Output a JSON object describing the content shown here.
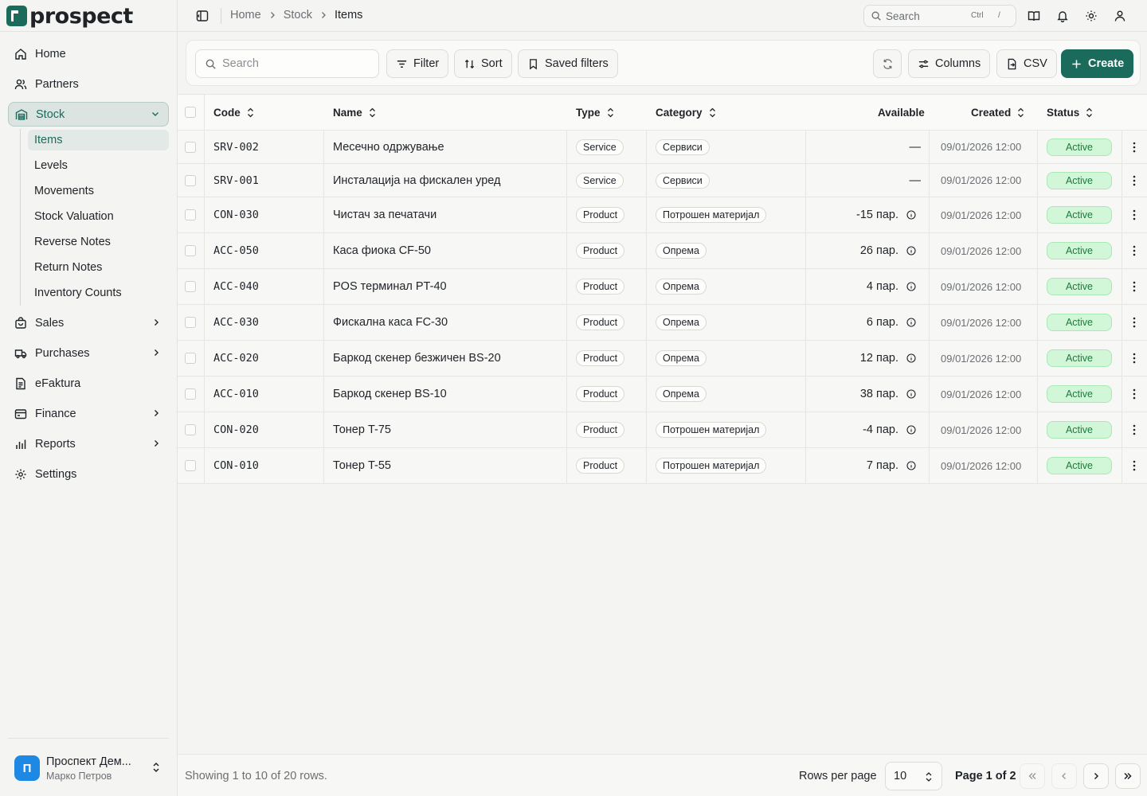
{
  "app": {
    "brand": "prospect",
    "accent": "#1a6b5c"
  },
  "sidebar": {
    "nav": [
      {
        "id": "home",
        "label": "Home",
        "icon": "home-icon"
      },
      {
        "id": "partners",
        "label": "Partners",
        "icon": "users-icon"
      },
      {
        "id": "stock",
        "label": "Stock",
        "icon": "warehouse-icon",
        "active": true
      },
      {
        "id": "sales",
        "label": "Sales",
        "icon": "bag-icon"
      },
      {
        "id": "purchases",
        "label": "Purchases",
        "icon": "truck-icon"
      },
      {
        "id": "efaktura",
        "label": "eFaktura",
        "icon": "document-icon"
      },
      {
        "id": "finance",
        "label": "Finance",
        "icon": "wallet-icon"
      },
      {
        "id": "reports",
        "label": "Reports",
        "icon": "bar-chart-icon"
      },
      {
        "id": "settings",
        "label": "Settings",
        "icon": "gear-icon"
      }
    ],
    "stock_sub": [
      "Items",
      "Levels",
      "Movements",
      "Stock Valuation",
      "Reverse Notes",
      "Return Notes",
      "Inventory Counts"
    ],
    "org": {
      "initial": "П",
      "name": "Проспект Дем...",
      "user": "Марко Петров"
    }
  },
  "topbar": {
    "breadcrumb": [
      "Home",
      "Stock",
      "Items"
    ],
    "search_label": "Search",
    "shortcut_ctrl": "Ctrl",
    "shortcut_key": "/"
  },
  "toolbar": {
    "search_placeholder": "Search",
    "filter": "Filter",
    "sort": "Sort",
    "saved_filters": "Saved filters",
    "columns": "Columns",
    "csv": "CSV",
    "create": "Create"
  },
  "table": {
    "columns": [
      "Code",
      "Name",
      "Type",
      "Category",
      "Available",
      "Created",
      "Status"
    ],
    "rows": [
      {
        "code": "SRV-002",
        "name": "Месечно одржување",
        "type": "Service",
        "category": "Сервиси",
        "available": "—",
        "created": "09/01/2026 12:00",
        "status": "Active"
      },
      {
        "code": "SRV-001",
        "name": "Инсталација на фискален уред",
        "type": "Service",
        "category": "Сервиси",
        "available": "—",
        "created": "09/01/2026 12:00",
        "status": "Active"
      },
      {
        "code": "CON-030",
        "name": "Чистач за печатачи",
        "type": "Product",
        "category": "Потрошен материјал",
        "available": "-15 пар.",
        "created": "09/01/2026 12:00",
        "status": "Active"
      },
      {
        "code": "ACC-050",
        "name": "Каса фиока CF-50",
        "type": "Product",
        "category": "Опрема",
        "available": "26 пар.",
        "created": "09/01/2026 12:00",
        "status": "Active"
      },
      {
        "code": "ACC-040",
        "name": "POS терминал PT-40",
        "type": "Product",
        "category": "Опрема",
        "available": "4 пар.",
        "created": "09/01/2026 12:00",
        "status": "Active"
      },
      {
        "code": "ACC-030",
        "name": "Фискална каса FC-30",
        "type": "Product",
        "category": "Опрема",
        "available": "6 пар.",
        "created": "09/01/2026 12:00",
        "status": "Active"
      },
      {
        "code": "ACC-020",
        "name": "Баркод скенер безжичен BS-20",
        "type": "Product",
        "category": "Опрема",
        "available": "12 пар.",
        "created": "09/01/2026 12:00",
        "status": "Active"
      },
      {
        "code": "ACC-010",
        "name": "Баркод скенер BS-10",
        "type": "Product",
        "category": "Опрема",
        "available": "38 пар.",
        "created": "09/01/2026 12:00",
        "status": "Active"
      },
      {
        "code": "CON-020",
        "name": "Тонер T-75",
        "type": "Product",
        "category": "Потрошен материјал",
        "available": "-4 пар.",
        "created": "09/01/2026 12:00",
        "status": "Active"
      },
      {
        "code": "CON-010",
        "name": "Тонер T-55",
        "type": "Product",
        "category": "Потрошен материјал",
        "available": "7 пар.",
        "created": "09/01/2026 12:00",
        "status": "Active"
      }
    ]
  },
  "footer": {
    "showing": "Showing 1 to 10 of 20 rows.",
    "rows_per_page_label": "Rows per page",
    "rows_per_page": "10",
    "page_label": "Page 1 of 2"
  },
  "colors": {
    "status_bg": "#d2f7d8",
    "status_text": "#1b7a3a",
    "accent": "#1a6b5c"
  }
}
